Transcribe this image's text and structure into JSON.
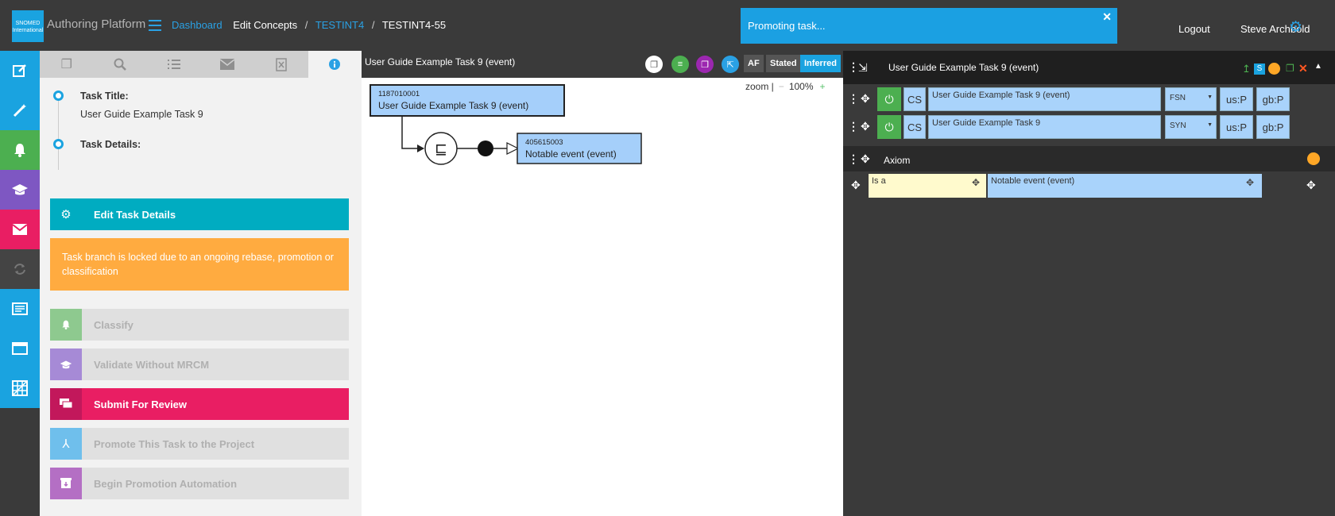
{
  "header": {
    "logo_text": "SNOMED International",
    "app_title": "Authoring Platform",
    "breadcrumbs": [
      "Dashboard",
      "Edit Concepts",
      "TESTINT4",
      "TESTINT4-55"
    ],
    "toast": "Promoting task...",
    "logout": "Logout",
    "user": "Steve Archbold"
  },
  "sidenav": {
    "items": [
      {
        "icon": "edit-icon",
        "color": "#1aa3e0"
      },
      {
        "icon": "wand-icon",
        "color": "#1aa3e0"
      },
      {
        "icon": "bell-icon",
        "color": "#4caf50"
      },
      {
        "icon": "graduation-cap-icon",
        "color": "#7e57c2"
      },
      {
        "icon": "envelope-icon",
        "color": "#e91e63"
      },
      {
        "icon": "sync-icon",
        "color": "#444444"
      },
      {
        "icon": "list-box-icon",
        "color": "#1aa3e0"
      },
      {
        "icon": "browser-icon",
        "color": "#1aa3e0"
      },
      {
        "icon": "grid-icon",
        "color": "#1aa3e0"
      }
    ]
  },
  "leftpanel": {
    "tabs": [
      "copy-icon",
      "search-icon",
      "list-icon",
      "mail-icon",
      "excel-icon",
      "info-icon"
    ],
    "task_title_label": "Task Title:",
    "task_title_value": "User Guide Example Task 9",
    "task_details_label": "Task Details:",
    "edit_button": "Edit Task Details",
    "warning": "Task branch is locked due to an ongoing rebase, promotion or classification",
    "actions": [
      {
        "label": "Classify",
        "color": "#4caf50",
        "enabled": false
      },
      {
        "label": "Validate Without MRCM",
        "color": "#7e57c2",
        "enabled": false
      },
      {
        "label": "Submit For Review",
        "color": "#e91e63",
        "enabled": true
      },
      {
        "label": "Promote This Task to the Project",
        "color": "#1aa3e0",
        "enabled": false
      },
      {
        "label": "Begin Promotion Automation",
        "color": "#9c27b0",
        "enabled": false
      }
    ]
  },
  "center": {
    "title": "User Guide Example Task 9 (event)",
    "af": "AF",
    "stated": "Stated",
    "inferred": "Inferred",
    "zoom_label": "zoom |",
    "zoom_minus": "−",
    "zoom_value": "100%",
    "zoom_plus": "+",
    "concept_id": "1187010001",
    "concept_name": "User Guide Example Task 9 (event)",
    "parent_id": "405615003",
    "parent_name": "Notable event (event)",
    "subsumption_symbol": "⊑"
  },
  "right": {
    "title": "User Guide Example Task 9 (event)",
    "descriptions": [
      {
        "cs": "CS",
        "term": "User Guide Example Task 9 (event)",
        "type": "FSN",
        "us": "us:P",
        "gb": "gb:P"
      },
      {
        "cs": "CS",
        "term": "User Guide Example Task 9",
        "type": "SYN",
        "us": "us:P",
        "gb": "gb:P"
      }
    ],
    "axiom_label": "Axiom",
    "relationship_type": "Is a",
    "relationship_target": "Notable event (event)"
  }
}
